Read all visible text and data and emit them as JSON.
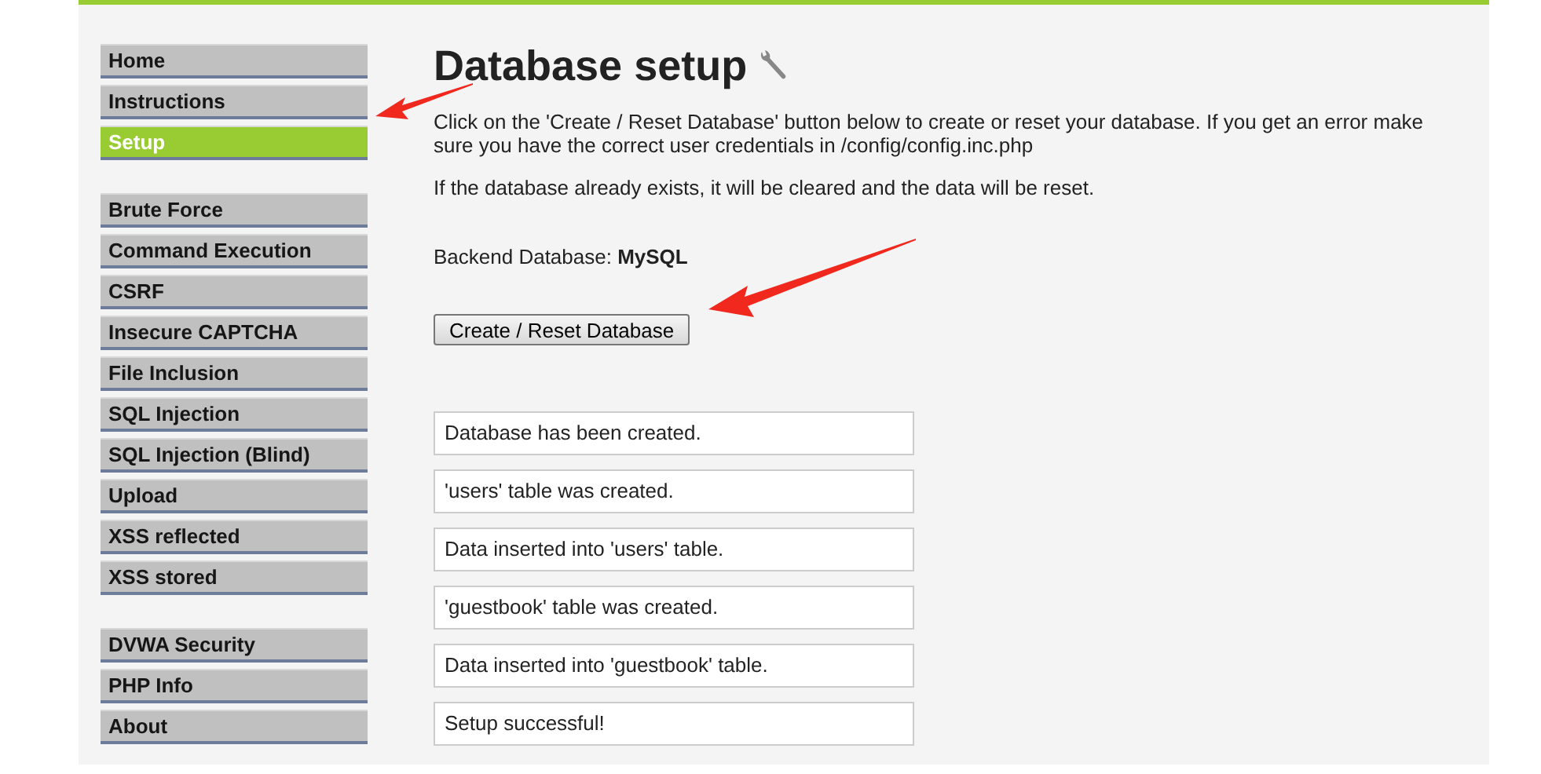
{
  "menu_groups": [
    {
      "items": [
        {
          "label": "Home",
          "selected": false
        },
        {
          "label": "Instructions",
          "selected": false
        },
        {
          "label": "Setup",
          "selected": true
        }
      ]
    },
    {
      "items": [
        {
          "label": "Brute Force",
          "selected": false
        },
        {
          "label": "Command Execution",
          "selected": false
        },
        {
          "label": "CSRF",
          "selected": false
        },
        {
          "label": "Insecure CAPTCHA",
          "selected": false
        },
        {
          "label": "File Inclusion",
          "selected": false
        },
        {
          "label": "SQL Injection",
          "selected": false
        },
        {
          "label": "SQL Injection (Blind)",
          "selected": false
        },
        {
          "label": "Upload",
          "selected": false
        },
        {
          "label": "XSS reflected",
          "selected": false
        },
        {
          "label": "XSS stored",
          "selected": false
        }
      ]
    },
    {
      "items": [
        {
          "label": "DVWA Security",
          "selected": false
        },
        {
          "label": "PHP Info",
          "selected": false
        },
        {
          "label": "About",
          "selected": false
        }
      ]
    }
  ],
  "title": "Database setup",
  "intro": "Click on the 'Create / Reset Database' button below to create or reset your database. If you get an error make sure you have the correct user credentials in /config/config.inc.php",
  "note": "If the database already exists, it will be cleared and the data will be reset.",
  "backend": "Backend Database: **MySQL**",
  "button": "Create / Reset Database",
  "messages": [
    "Database has been created.",
    "'users' table was created.",
    "Data inserted into 'users' table.",
    "'guestbook' table was created.",
    "Data inserted into 'guestbook' table.",
    "Setup successful!"
  ]
}
